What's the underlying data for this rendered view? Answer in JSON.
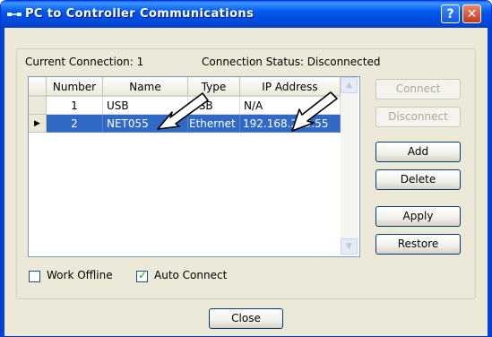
{
  "window": {
    "title": "PC to Controller Communications",
    "help_glyph": "?",
    "close_glyph": "✕"
  },
  "status": {
    "current_connection_label": "Current Connection: 1",
    "connection_status_label": "Connection Status: Disconnected"
  },
  "table": {
    "headers": [
      "Number",
      "Name",
      "Type",
      "IP Address"
    ],
    "rows": [
      {
        "number": "1",
        "name": "USB",
        "type": "USB",
        "ip": "N/A"
      },
      {
        "number": "2",
        "name": "NET055",
        "type": "Ethernet",
        "ip": "192.168.219.55"
      }
    ],
    "selected_row_marker": "▶"
  },
  "buttons": {
    "connect": "Connect",
    "disconnect": "Disconnect",
    "add": "Add",
    "delete": "Delete",
    "apply": "Apply",
    "restore": "Restore",
    "close": "Close"
  },
  "options": {
    "work_offline": {
      "label": "Work Offline",
      "checked": false
    },
    "auto_connect": {
      "label": "Auto Connect",
      "checked": true
    }
  },
  "colors": {
    "title_bar": "#0046d5",
    "selection": "#316ac5",
    "annotation_arrow": "#000000"
  }
}
